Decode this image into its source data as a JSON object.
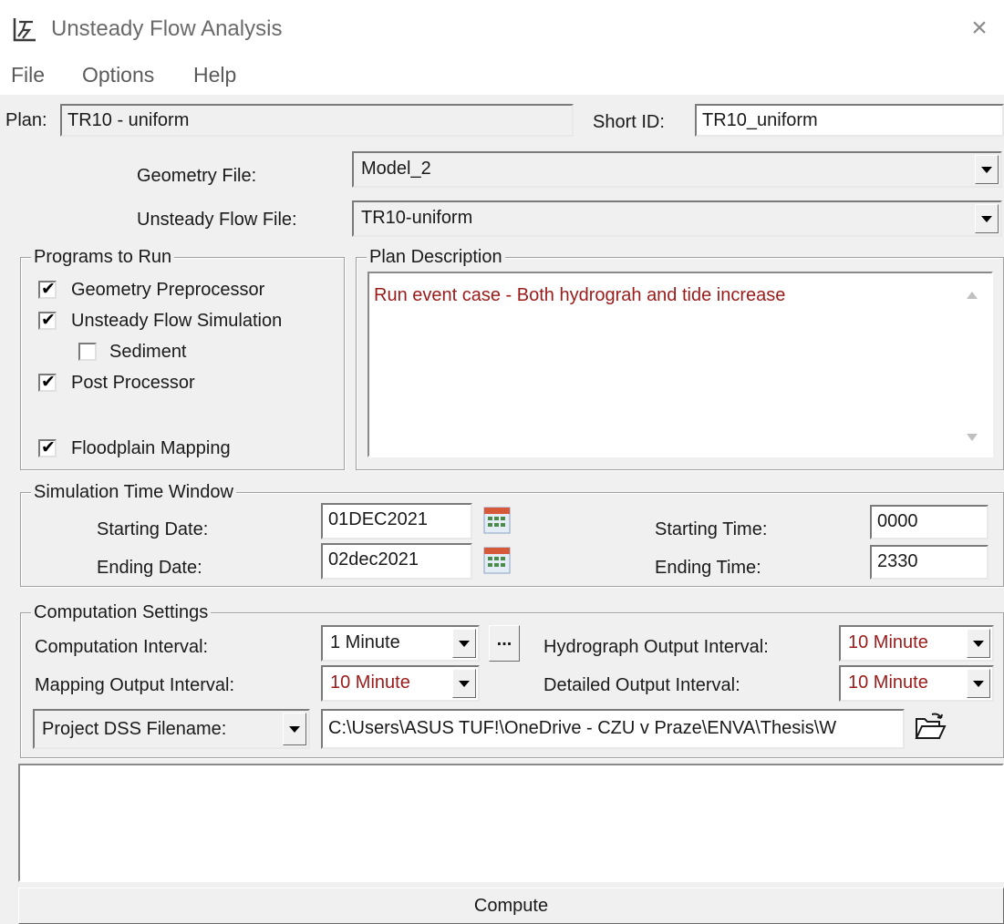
{
  "window": {
    "title": "Unsteady Flow Analysis",
    "close": "×"
  },
  "menu": {
    "file": "File",
    "options": "Options",
    "help": "Help"
  },
  "plan": {
    "label": "Plan:",
    "value": "TR10 - uniform",
    "short_id_label": "Short ID:",
    "short_id_value": "TR10_uniform"
  },
  "files": {
    "geometry_label": "Geometry File:",
    "geometry_value": "Model_2",
    "unsteady_label": "Unsteady Flow File:",
    "unsteady_value": "TR10-uniform"
  },
  "programs": {
    "title": "Programs to Run",
    "items": [
      {
        "label": "Geometry Preprocessor",
        "checked": true
      },
      {
        "label": "Unsteady Flow Simulation",
        "checked": true
      },
      {
        "label": "Sediment",
        "checked": false
      },
      {
        "label": "Post Processor",
        "checked": true
      },
      {
        "label": "Floodplain Mapping",
        "checked": true
      }
    ]
  },
  "description": {
    "title": "Plan Description",
    "text": "Run event case - Both hydrograh and tide increase"
  },
  "time_window": {
    "title": "Simulation Time Window",
    "start_date_label": "Starting Date:",
    "start_date": "01DEC2021",
    "end_date_label": "Ending Date:",
    "end_date": "02dec2021",
    "start_time_label": "Starting Time:",
    "start_time": "0000",
    "end_time_label": "Ending Time:",
    "end_time": "2330"
  },
  "computation": {
    "title": "Computation Settings",
    "interval_label": "Computation Interval:",
    "interval_value": "1 Minute",
    "more_button": "...",
    "hydro_label": "Hydrograph Output Interval:",
    "hydro_value": "10 Minute",
    "mapping_label": "Mapping Output Interval:",
    "mapping_value": "10 Minute",
    "detailed_label": "Detailed Output Interval:",
    "detailed_value": "10 Minute",
    "dss_select": "Project DSS Filename:",
    "dss_path": "C:\\Users\\ASUS TUF!\\OneDrive - CZU v Praze\\ENVA\\Thesis\\W"
  },
  "compute_button": "Compute",
  "colors": {
    "accent_red": "#9b1b1b",
    "window_bg": "#f0f0f0"
  }
}
